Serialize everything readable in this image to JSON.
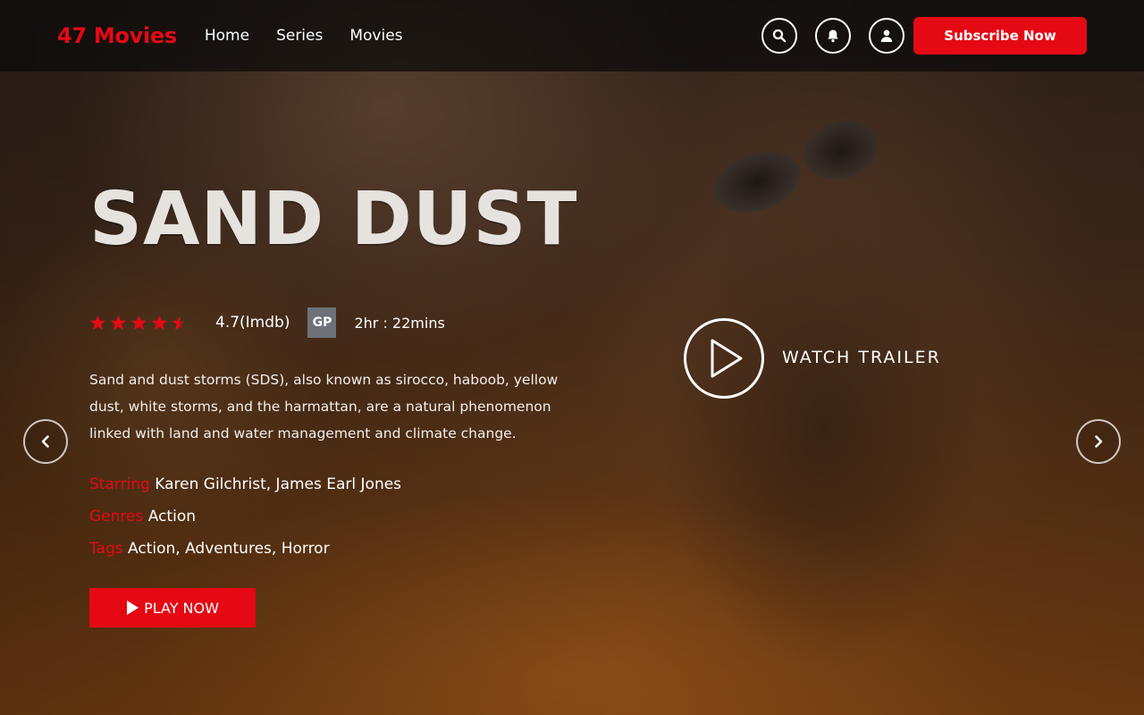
{
  "header": {
    "logo": "47 Movies",
    "nav": [
      "Home",
      "Series",
      "Movies"
    ],
    "icons": [
      "search-icon",
      "bell-icon",
      "user-icon"
    ],
    "subscribe_label": "Subscribe Now"
  },
  "hero": {
    "title": "SAND DUST",
    "stars_value": 4.5,
    "rating": "4.7(Imdb)",
    "badge": "GP",
    "duration": "2hr : 22mins",
    "description": "Sand and dust storms (SDS), also known as sirocco, haboob, yellow dust, white storms, and the harmattan, are a natural phenomenon linked with land and water management and climate change.",
    "starring_label": "Starring",
    "starring_value": "Karen Gilchrist, James Earl Jones",
    "genres_label": "Genres",
    "genres_value": "Action",
    "tags_label": "Tags",
    "tags_value": "Action, Adventures, Horror",
    "play_label": "PLAY NOW",
    "trailer_label": "WATCH TRAILER"
  },
  "colors": {
    "accent": "#e50914",
    "badge": "#6d7278",
    "header_bg": "#0a0a0a"
  }
}
